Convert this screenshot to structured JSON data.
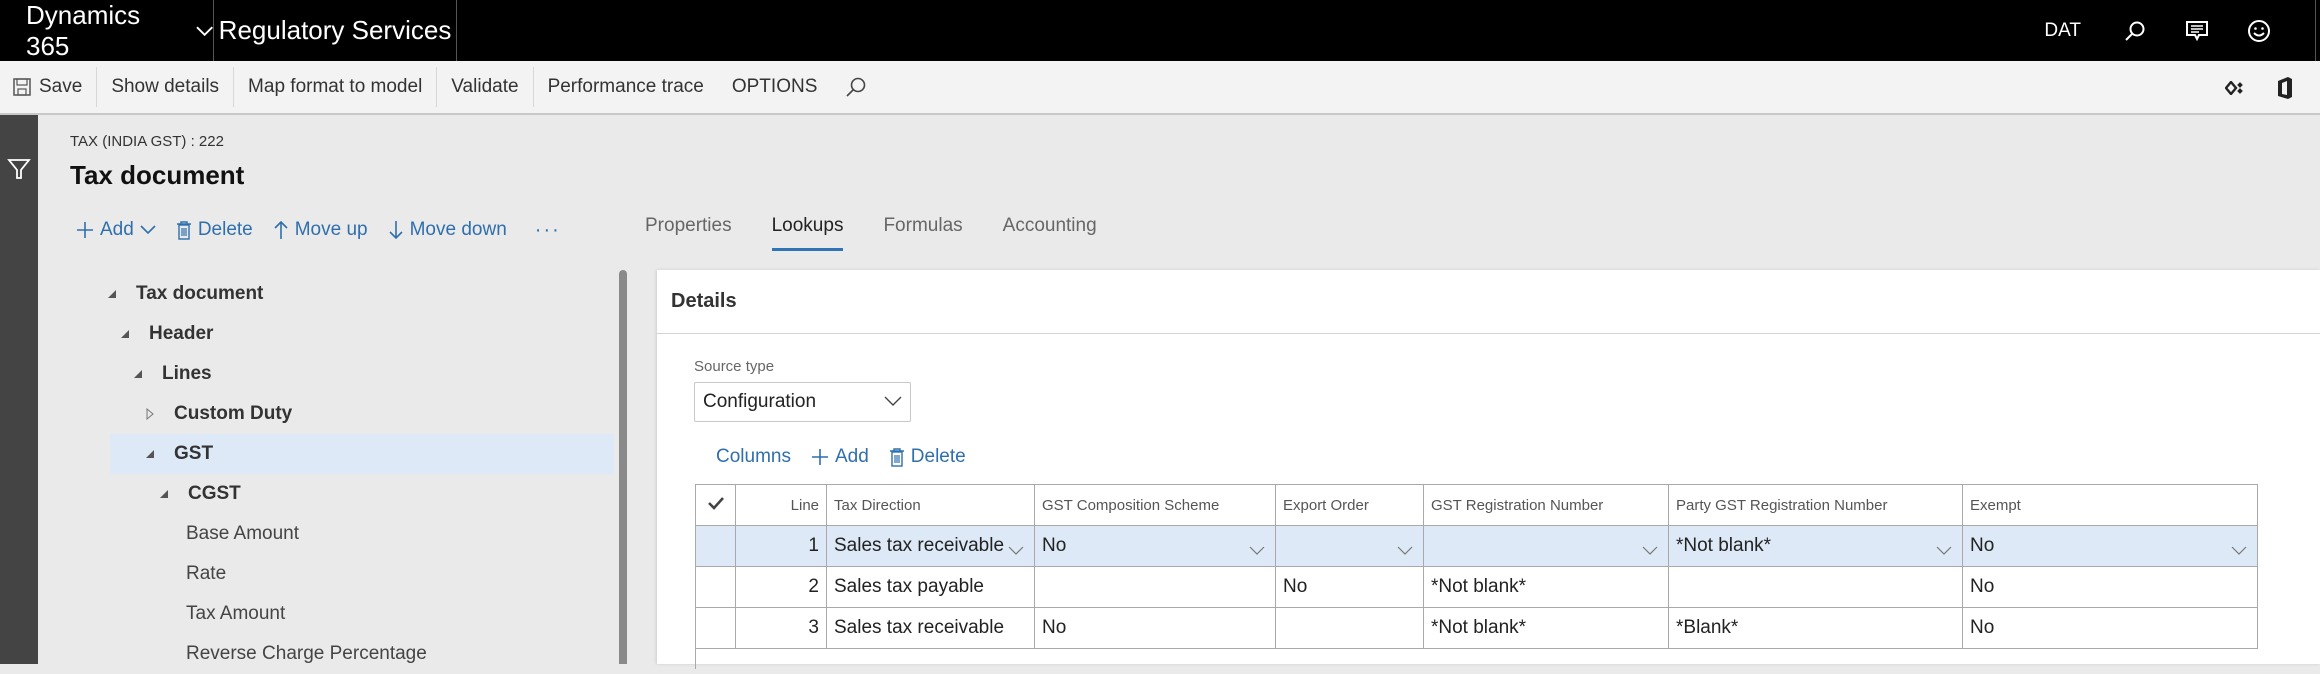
{
  "topbar": {
    "app_name": "Dynamics 365",
    "module": "Regulatory Services",
    "company": "DAT",
    "icons": [
      "search-icon",
      "feedback-icon",
      "smiley-icon"
    ]
  },
  "toolbar": {
    "save": "Save",
    "show_details": "Show details",
    "map_format": "Map format to model",
    "validate": "Validate",
    "performance_trace": "Performance trace",
    "options": "OPTIONS",
    "right_icons": [
      "connector-icon",
      "office-icon"
    ]
  },
  "page": {
    "caption": "TAX (INDIA GST) : 222",
    "title": "Tax document"
  },
  "tree_actions": {
    "add": "Add",
    "delete": "Delete",
    "move_up": "Move up",
    "move_down": "Move down",
    "more": "···"
  },
  "tabs": [
    {
      "label": "Properties",
      "active": false
    },
    {
      "label": "Lookups",
      "active": true
    },
    {
      "label": "Formulas",
      "active": false
    },
    {
      "label": "Accounting",
      "active": false
    }
  ],
  "tree": [
    {
      "label": "Tax document",
      "state": "expanded",
      "selected": false
    },
    {
      "label": "Header",
      "state": "expanded",
      "selected": false
    },
    {
      "label": "Lines",
      "state": "expanded",
      "selected": false
    },
    {
      "label": "Custom Duty",
      "state": "collapsed",
      "selected": false
    },
    {
      "label": "GST",
      "state": "expanded",
      "selected": true
    },
    {
      "label": "CGST",
      "state": "expanded",
      "selected": false
    },
    {
      "label": "Base Amount",
      "state": "leaf",
      "selected": false
    },
    {
      "label": "Rate",
      "state": "leaf",
      "selected": false
    },
    {
      "label": "Tax Amount",
      "state": "leaf",
      "selected": false
    },
    {
      "label": "Reverse Charge Percentage",
      "state": "leaf",
      "selected": false
    }
  ],
  "details": {
    "header": "Details",
    "source_type_label": "Source type",
    "source_type_value": "Configuration",
    "grid_actions": {
      "columns": "Columns",
      "add": "Add",
      "delete": "Delete"
    },
    "grid": {
      "columns": [
        "",
        "Line",
        "Tax Direction",
        "GST Composition Scheme",
        "Export Order",
        "GST Registration Number",
        "Party GST Registration Number",
        "Exempt"
      ],
      "rows": [
        {
          "selected": true,
          "cells": [
            "",
            "1",
            "Sales tax receivable",
            "No",
            "",
            "",
            "*Not blank*",
            "No"
          ]
        },
        {
          "selected": false,
          "cells": [
            "",
            "2",
            "Sales tax payable",
            "",
            "No",
            "*Not blank*",
            "",
            "No"
          ]
        },
        {
          "selected": false,
          "cells": [
            "",
            "3",
            "Sales tax receivable",
            "No",
            "",
            "*Not blank*",
            "*Blank*",
            "No"
          ]
        }
      ]
    }
  }
}
